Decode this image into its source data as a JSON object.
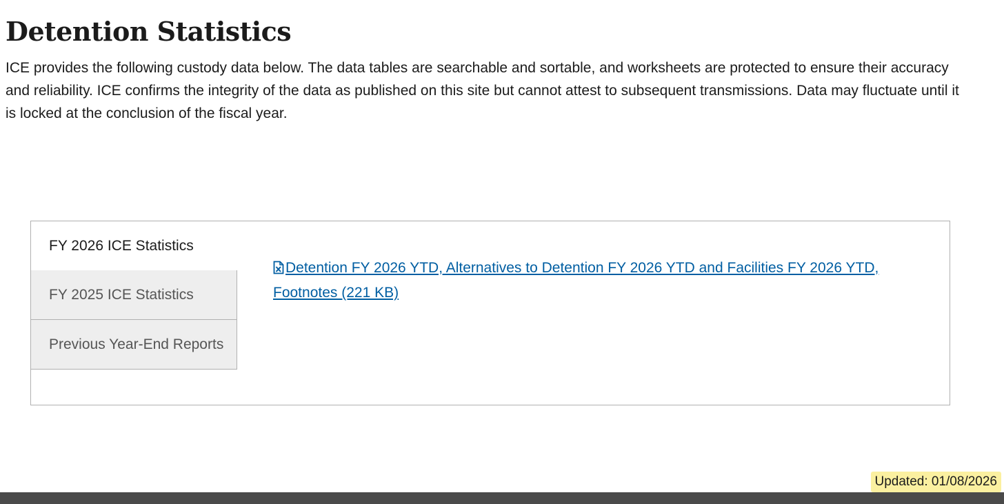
{
  "page": {
    "title": "Detention Statistics",
    "intro": "ICE provides the following custody data below. The data tables are searchable and sortable, and worksheets are protected to ensure their accuracy and reliability. ICE confirms the integrity of the data as published on this site but cannot attest to subsequent transmissions. Data may fluctuate until it is locked at the conclusion of the fiscal year."
  },
  "tabs": [
    {
      "label": "FY 2026 ICE Statistics",
      "active": true
    },
    {
      "label": "FY 2025 ICE Statistics",
      "active": false
    },
    {
      "label": "Previous Year-End Reports",
      "active": false
    }
  ],
  "tab_content": {
    "link_text": "Detention FY 2026 YTD, Alternatives to Detention FY 2026 YTD and Facilities FY 2026 YTD, Footnotes (221 KB)",
    "icon": "excel-file-icon",
    "link_color": "#005ea2"
  },
  "footer": {
    "updated": "Updated: 01/08/2026",
    "highlight_color": "#fbf0a0",
    "bar_color": "#4a4a4a"
  }
}
